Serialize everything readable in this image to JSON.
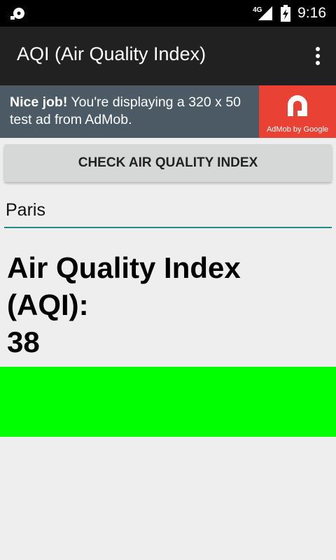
{
  "status_bar": {
    "network_type": "4G",
    "time": "9:16",
    "left_icon": "sync-disc-icon"
  },
  "app_bar": {
    "title": "AQI (Air Quality Index)",
    "menu_icon": "overflow-menu-icon"
  },
  "ad": {
    "bold_text": "Nice job!",
    "text": " You're displaying a 320 x 50 test ad from AdMob.",
    "logo_caption": "AdMob by Google",
    "logo_color": "#e94234",
    "background_color": "#4b5a64"
  },
  "main": {
    "check_button_label": "CHECK AIR QUALITY INDEX",
    "city_input_value": "Paris",
    "aqi_label_line1": "Air Quality Index",
    "aqi_label_line2": "(AQI):",
    "aqi_value": "38",
    "aqi_color": "#00ff00",
    "accent_color": "#1e8c80"
  }
}
